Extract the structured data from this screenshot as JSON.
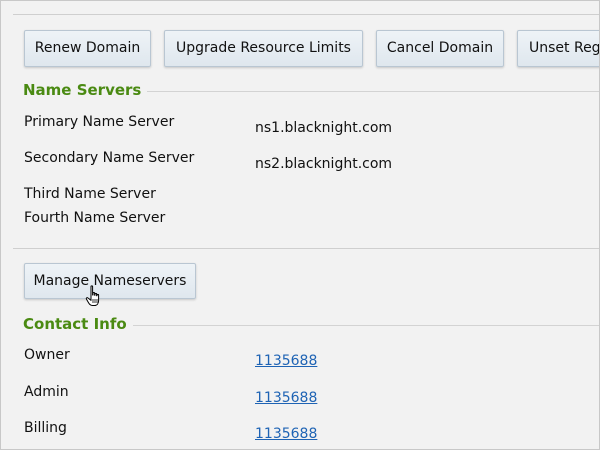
{
  "toolbar": {
    "renew_label": "Renew Domain",
    "upgrade_label": "Upgrade Resource Limits",
    "cancel_label": "Cancel Domain",
    "unset_label": "Unset Reg"
  },
  "name_servers": {
    "title": "Name Servers",
    "rows": [
      {
        "label": "Primary Name Server",
        "value": "ns1.blacknight.com"
      },
      {
        "label": "Secondary Name Server",
        "value": "ns2.blacknight.com"
      },
      {
        "label": "Third Name Server",
        "value": ""
      },
      {
        "label": "Fourth Name Server",
        "value": ""
      }
    ],
    "manage_label": "Manage Nameservers"
  },
  "contact_info": {
    "title": "Contact Info",
    "rows": [
      {
        "label": "Owner",
        "value": "1135688"
      },
      {
        "label": "Admin",
        "value": "1135688"
      },
      {
        "label": "Billing",
        "value": "1135688"
      }
    ]
  },
  "colors": {
    "section_title": "#4a8a12",
    "link": "#1e63b4",
    "button_border": "#b9c6d2"
  },
  "icons": {
    "cursor": "hand-pointer-cursor-icon"
  }
}
